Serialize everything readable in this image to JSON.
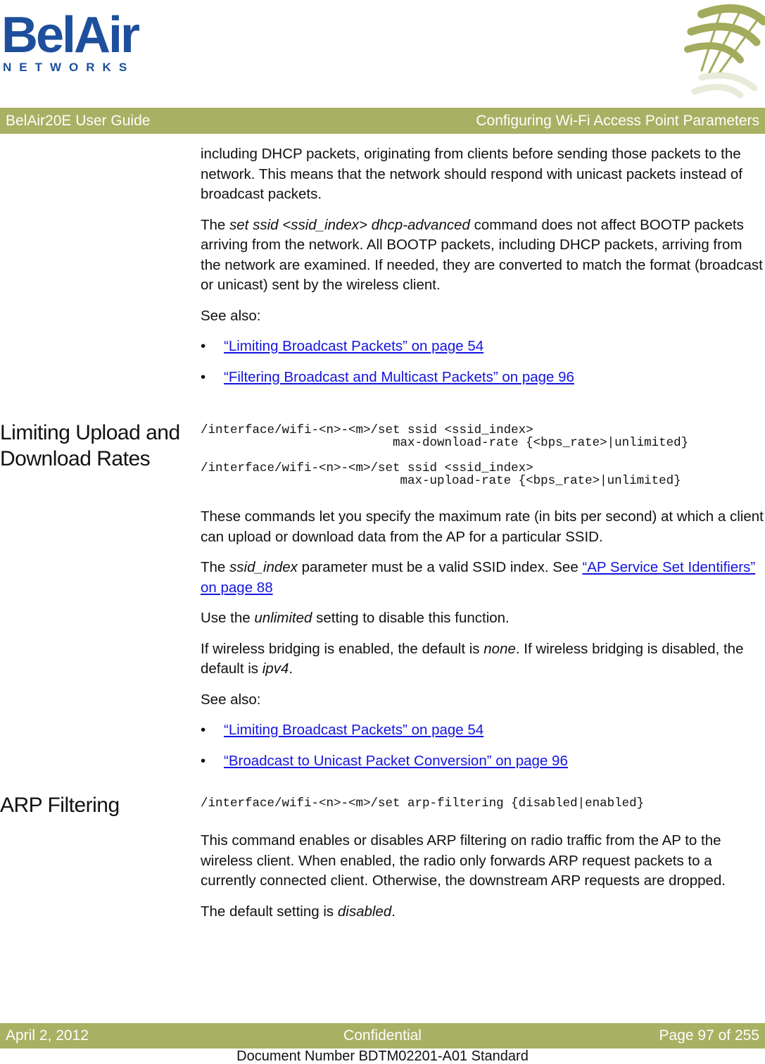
{
  "logo": {
    "brand": "BelAir",
    "sub": "NETWORKS",
    "color": "#1d4f9c"
  },
  "header": {
    "left": "BelAir20E User Guide",
    "right": "Configuring Wi-Fi Access Point Parameters",
    "bar_color": "#a8b063"
  },
  "intro": {
    "p1": "including DHCP packets, originating from clients before sending those packets to the network. This means that the network should respond with unicast packets instead of broadcast packets.",
    "p2_pre": "The ",
    "p2_italic": "set ssid <ssid_index> dhcp-advanced",
    "p2_post": " command does not affect BOOTP packets arriving from the network. All BOOTP packets, including DHCP packets, arriving from the network are examined. If needed, they are converted to match the format (broadcast or unicast) sent by the wireless client.",
    "see_also": "See also:",
    "links": [
      "“Limiting Broadcast Packets” on page 54",
      "“Filtering Broadcast and Multicast Packets” on page 96"
    ]
  },
  "rates": {
    "heading": "Limiting Upload and Download Rates",
    "code1": "/interface/wifi-<n>-<m>/set ssid <ssid_index>\n                          max-download-rate {<bps_rate>|unlimited}",
    "code2": "/interface/wifi-<n>-<m>/set ssid <ssid_index>\n                           max-upload-rate {<bps_rate>|unlimited}",
    "p1": "These commands let you specify the maximum rate (in bits per second) at which a client can upload or download data from the AP for a particular SSID.",
    "p2_pre": "The ",
    "p2_italic": "ssid_index",
    "p2_mid": " parameter must be a valid SSID index. See ",
    "p2_link": "“AP Service Set Identifiers” on page 88",
    "p3_pre": "Use the ",
    "p3_italic": "unlimited",
    "p3_post": " setting to disable this function.",
    "p4_a": "If wireless bridging is enabled, the default is ",
    "p4_i1": "none",
    "p4_b": ". If wireless bridging is disabled, the default is ",
    "p4_i2": "ipv4",
    "p4_c": ".",
    "see_also": "See also:",
    "links": [
      "“Limiting Broadcast Packets” on page 54",
      "“Broadcast to Unicast Packet Conversion” on page 96"
    ]
  },
  "arp": {
    "heading": "ARP Filtering",
    "code": "/interface/wifi-<n>-<m>/set arp-filtering {disabled|enabled}",
    "p1": "This command enables or disables ARP filtering on radio traffic from the AP to the wireless client. When enabled, the radio only forwards ARP request packets to a currently connected client. Otherwise, the downstream ARP requests are dropped.",
    "p2_pre": "The default setting is ",
    "p2_italic": "disabled",
    "p2_post": "."
  },
  "bullet": "•",
  "footer": {
    "date": "April 2, 2012",
    "classification": "Confidential",
    "page": "Page 97 of 255",
    "doc_number": "Document Number BDTM02201-A01 Standard"
  }
}
